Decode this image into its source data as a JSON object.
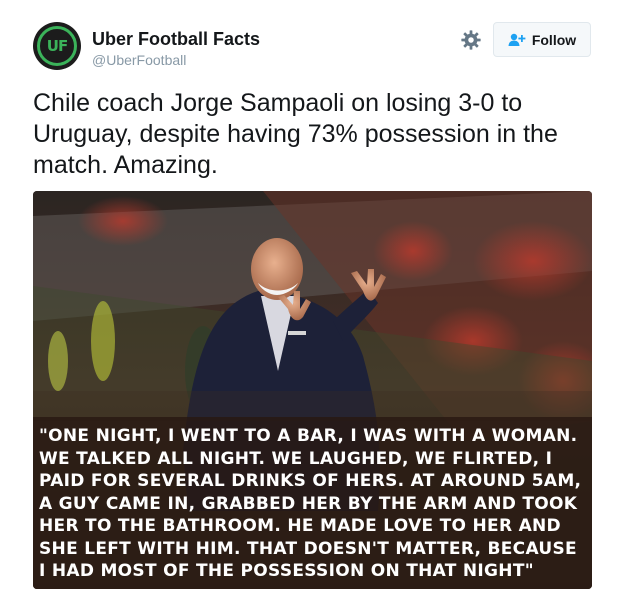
{
  "account": {
    "name": "Uber Football Facts",
    "handle": "@UberFootball",
    "avatar_text": "UF"
  },
  "actions": {
    "settings_icon": "gear-icon",
    "follow_icon": "add-user-icon",
    "follow_label": "Follow"
  },
  "tweet": {
    "text": "Chile coach Jorge Sampaoli on losing 3-0 to Uruguay, despite having 73% possession in the match. Amazing."
  },
  "media": {
    "quote": "\"One night, I went to a bar, I was with a woman. We talked all night. We laughed, we flirted, I paid for several drinks of hers. At around 5am, a guy came in, grabbed her by the arm and took her to the bathroom. He made love to her and she left with him. That doesn't matter, because I had most of the possession on that night\""
  },
  "colors": {
    "brand_green": "#3bb35a",
    "handle_gray": "#8899a6",
    "follow_icon_blue": "#1da1f2"
  }
}
